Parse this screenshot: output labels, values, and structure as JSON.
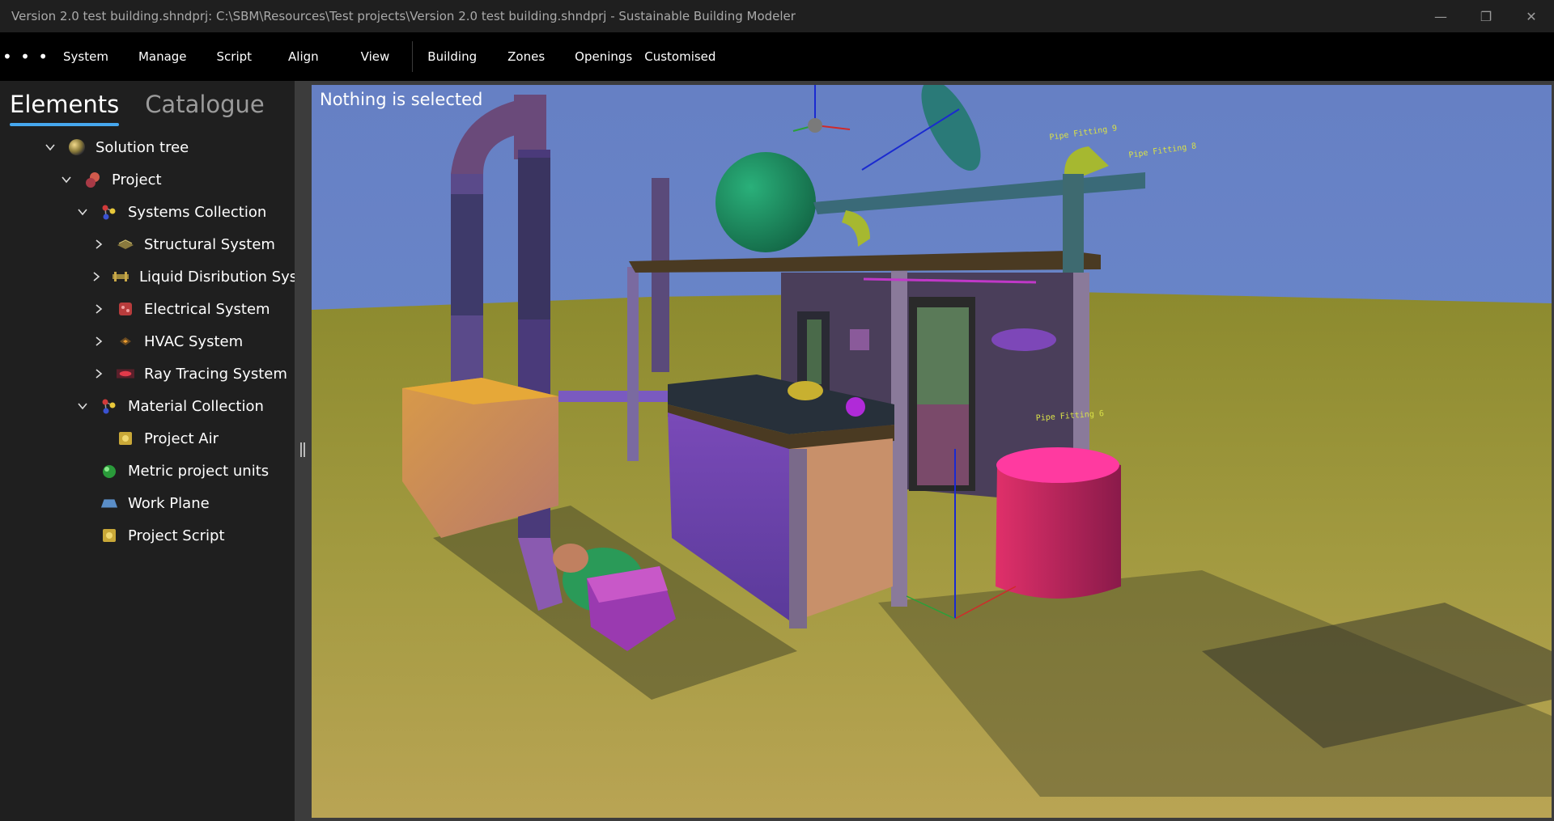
{
  "window": {
    "title": "Version 2.0 test building.shndprj:  C:\\SBM\\Resources\\Test projects\\Version 2.0 test building.shndprj - Sustainable Building Modeler",
    "minimize_glyph": "—",
    "restore_glyph": "❐",
    "close_glyph": "✕"
  },
  "menu": {
    "more_glyph": "• • •",
    "items": [
      "System",
      "Manage",
      "Script",
      "Align",
      "View",
      "Building",
      "Zones",
      "Openings",
      "Customised"
    ]
  },
  "panel": {
    "tabs": [
      {
        "label": "Elements",
        "active": true
      },
      {
        "label": "Catalogue",
        "active": false
      }
    ],
    "tree": [
      {
        "label": "Solution tree",
        "depth": 0,
        "expander": "expanded",
        "icon": "sphere-icon"
      },
      {
        "label": "Project",
        "depth": 1,
        "expander": "expanded",
        "icon": "project-icon"
      },
      {
        "label": "Systems Collection",
        "depth": 2,
        "expander": "expanded",
        "icon": "collection-icon"
      },
      {
        "label": "Structural System",
        "depth": 3,
        "expander": "collapsed",
        "icon": "structural-icon"
      },
      {
        "label": "Liquid Disribution System",
        "depth": 3,
        "expander": "collapsed",
        "icon": "liquid-icon"
      },
      {
        "label": "Electrical System",
        "depth": 3,
        "expander": "collapsed",
        "icon": "electrical-icon"
      },
      {
        "label": "HVAC System",
        "depth": 3,
        "expander": "collapsed",
        "icon": "hvac-icon"
      },
      {
        "label": "Ray Tracing System",
        "depth": 3,
        "expander": "collapsed",
        "icon": "raytracing-icon"
      },
      {
        "label": "Material Collection",
        "depth": 2,
        "expander": "expanded",
        "icon": "collection-icon"
      },
      {
        "label": "Project Air",
        "depth": 3,
        "expander": "none",
        "icon": "material-icon"
      },
      {
        "label": "Metric project units",
        "depth": 2,
        "expander": "none",
        "icon": "units-icon"
      },
      {
        "label": "Work Plane",
        "depth": 2,
        "expander": "none",
        "icon": "workplane-icon"
      },
      {
        "label": "Project Script",
        "depth": 2,
        "expander": "none",
        "icon": "script-icon"
      }
    ]
  },
  "viewport": {
    "status": "Nothing is selected",
    "scene_labels": [
      "Pipe Fitting 9",
      "Pipe Fitting 8",
      "Pipe Fitting 6"
    ]
  },
  "colors": {
    "sky": "#6a86c8",
    "ground": "#9a9335",
    "accent": "#46a7ee"
  }
}
